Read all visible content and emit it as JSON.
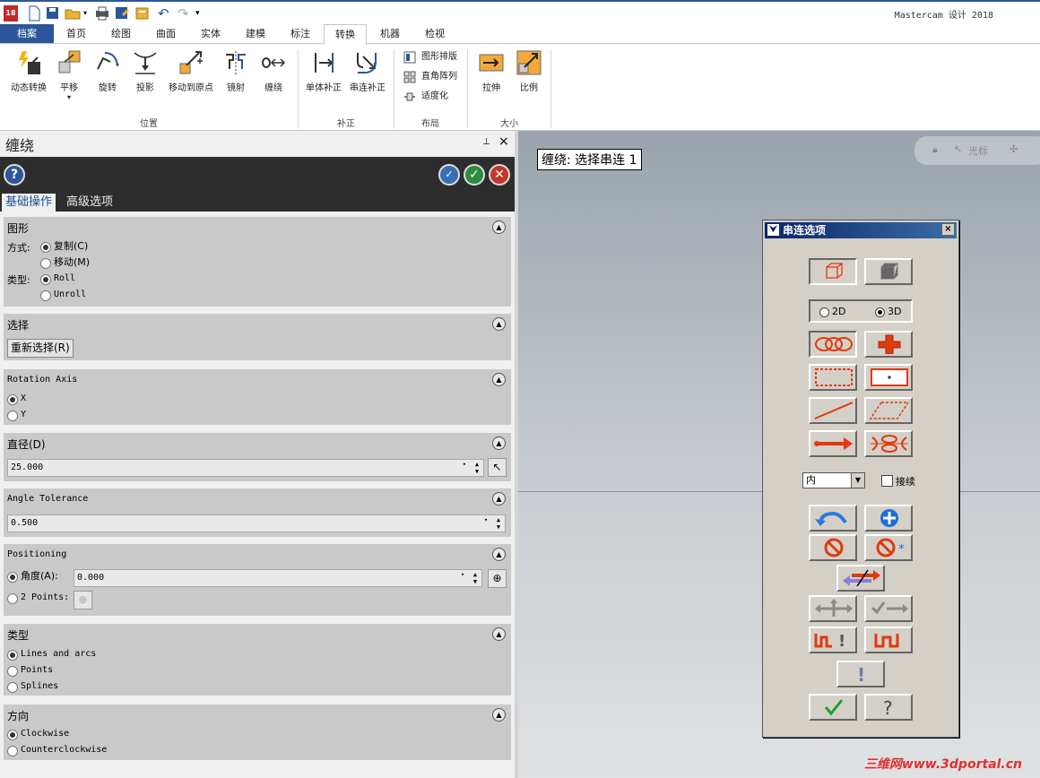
{
  "app_title": "Mastercam 设计 2018",
  "tabs": [
    "档案",
    "首页",
    "绘图",
    "曲面",
    "实体",
    "建模",
    "标注",
    "转换",
    "机器",
    "检视"
  ],
  "ribbon": {
    "position_group": {
      "label": "位置",
      "buttons": [
        "动态转换",
        "平移",
        "旋转",
        "投影",
        "移动到原点",
        "镜射",
        "缠绕"
      ]
    },
    "offset_group": {
      "label": "补正",
      "buttons": [
        "单体补正",
        "串连补正"
      ]
    },
    "layout_group": {
      "label": "布局",
      "buttons": [
        "图形排版",
        "直角阵列",
        "适度化"
      ]
    },
    "size_group": {
      "label": "大小",
      "buttons": [
        "拉伸",
        "比例"
      ]
    }
  },
  "panel": {
    "title": "缠绕",
    "pin": "⊥",
    "close": "×",
    "help": "?",
    "tab_basic": "基础操作",
    "tab_advanced": "高级选项",
    "graphics": {
      "title": "图形",
      "method_label": "方式:",
      "copy": "复制(C)",
      "move": "移动(M)",
      "type_label": "类型:",
      "roll": "Roll",
      "unroll": "Unroll"
    },
    "select": {
      "title": "选择",
      "reselect": "重新选择(R)"
    },
    "rotation_axis": {
      "title": "Rotation Axis",
      "x": "X",
      "y": "Y"
    },
    "diameter": {
      "title": "直径(D)",
      "value": "25.000"
    },
    "angle_tolerance": {
      "title": "Angle Tolerance",
      "value": "0.500"
    },
    "positioning": {
      "title": "Positioning",
      "angle_label": "角度(A):",
      "angle_value": "0.000",
      "two_points": "2 Points:"
    },
    "type": {
      "title": "类型",
      "lines_arcs": "Lines and arcs",
      "points": "Points",
      "splines": "Splines"
    },
    "direction": {
      "title": "方向",
      "cw": "Clockwise",
      "ccw": "Counterclockwise"
    }
  },
  "viewport": {
    "prompt": "缠绕: 选择串连 1",
    "toolbar_text": "光标"
  },
  "chain_dialog": {
    "title": "串连选项",
    "close": "×",
    "dim_2d": "2D",
    "dim_3d": "3D",
    "selected_dim": "3D",
    "inner_value": "内",
    "continue_label": "接续"
  },
  "watermark": "三维网www.3dportal.cn",
  "colors": {
    "accent": "#2b579a",
    "chain_red": "#e03a0e"
  }
}
